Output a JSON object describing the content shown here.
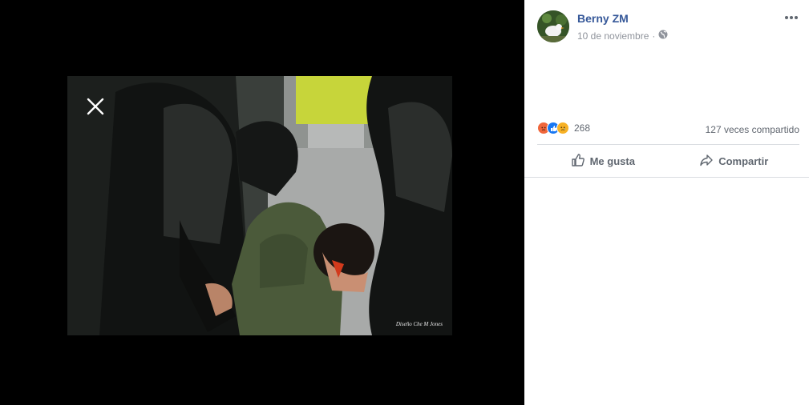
{
  "post": {
    "author": "Berny ZM",
    "date": "10 de noviembre",
    "privacy_icon": "globe-icon",
    "reactions": {
      "icons": [
        "angry-icon",
        "like-icon",
        "sad-icon"
      ],
      "count": "268"
    },
    "shares": "127 veces compartido",
    "actions": {
      "like": "Me gusta",
      "share": "Compartir"
    }
  },
  "photo": {
    "watermark": "Diseño Che M Jones"
  },
  "colors": {
    "author_link": "#365899",
    "meta_text": "#90949c",
    "action_text": "#606770",
    "like_blue": "#1877f2",
    "angry_orange": "#f0663b",
    "sad_yellow": "#f7b125"
  }
}
